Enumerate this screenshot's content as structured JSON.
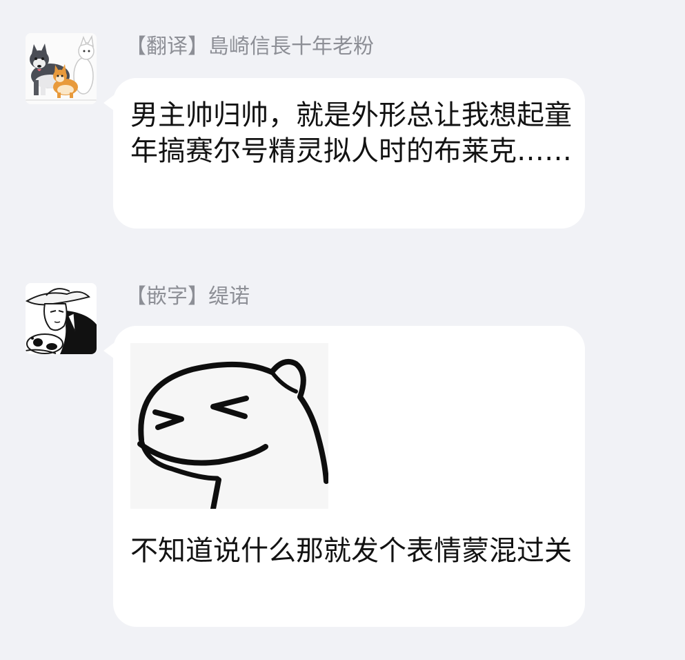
{
  "messages": [
    {
      "sender": "【翻译】島崎信長十年老粉",
      "avatar_icon": "dogs-avatar-icon",
      "text": "男主帅归帅，就是外形总让我想起童年搞赛尔号精灵拟人时的布莱克……"
    },
    {
      "sender": "【嵌字】缇诺",
      "avatar_icon": "cowboy-avatar-icon",
      "sticker_icon": "squinting-dinosaur-sticker-icon",
      "text": "不知道说什么那就发个表情蒙混过关"
    }
  ],
  "colors": {
    "background": "#f1f2f6",
    "bubble": "#ffffff",
    "sender_name": "#8d8f96",
    "message_text": "#121212"
  }
}
